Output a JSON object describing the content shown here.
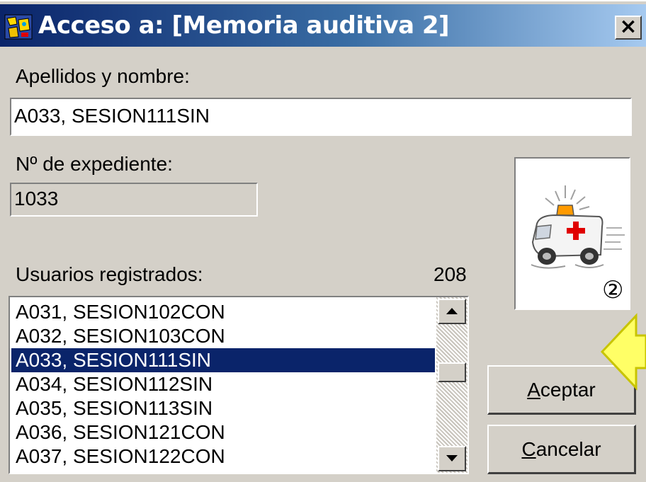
{
  "window": {
    "title": "Acceso a: [Memoria auditiva 2]",
    "close_symbol": "×",
    "icon": "app-icon"
  },
  "form": {
    "name_label": "Apellidos y nombre:",
    "name_value": "A033, SESION111SIN",
    "record_label": "Nº de expediente:",
    "record_value": "1033",
    "users_label": "Usuarios registrados:",
    "users_count": "208"
  },
  "user_list": {
    "items": [
      "A031, SESION102CON",
      "A032, SESION103CON",
      "A033, SESION111SIN",
      "A034, SESION112SIN",
      "A035, SESION113SIN",
      "A036, SESION121CON",
      "A037, SESION122CON"
    ],
    "selected_index": 2
  },
  "picture": {
    "icon": "ambulance-icon",
    "badge": "②"
  },
  "buttons": {
    "accept_first": "A",
    "accept_rest": "ceptar",
    "cancel_first": "C",
    "cancel_rest": "ancelar"
  },
  "colors": {
    "title_active": "#0a246a",
    "dialog_bg": "#d4d0c8",
    "selection": "#0a246a",
    "arrow_fill": "#ffff66",
    "cross_red": "#e00000"
  }
}
